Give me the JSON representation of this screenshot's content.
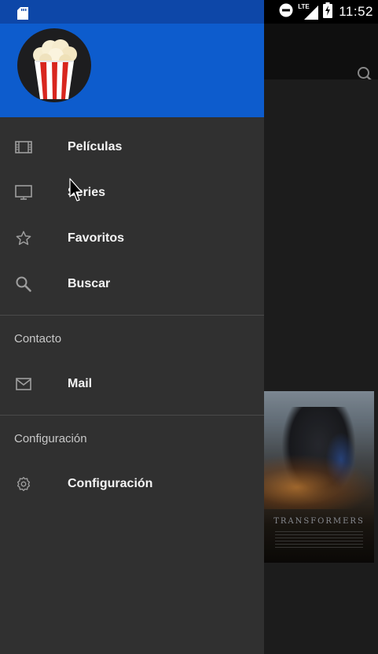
{
  "status_bar": {
    "network": "LTE",
    "time": "11:52",
    "icons": [
      "sd-card-icon",
      "do-not-disturb-icon",
      "lte-signal-icon",
      "battery-charging-icon"
    ]
  },
  "app": {
    "toolbar_icons": [
      "search-icon"
    ],
    "poster_title": "TRANSFORMERS"
  },
  "drawer": {
    "header_icon": "popcorn-logo-icon",
    "items": [
      {
        "icon": "film-icon",
        "label": "Películas"
      },
      {
        "icon": "tv-icon",
        "label": "Series"
      },
      {
        "icon": "star-icon",
        "label": "Favoritos"
      },
      {
        "icon": "search-icon",
        "label": "Buscar"
      }
    ],
    "sections": [
      {
        "header": "Contacto",
        "items": [
          {
            "icon": "mail-icon",
            "label": "Mail"
          }
        ]
      },
      {
        "header": "Configuración",
        "items": [
          {
            "icon": "settings-icon",
            "label": "Configuración"
          }
        ]
      }
    ]
  },
  "colors": {
    "primary": "#0d5ccd",
    "status_bar_drawer": "#0d47a8",
    "drawer_bg": "#303030",
    "app_bg": "#202020"
  }
}
